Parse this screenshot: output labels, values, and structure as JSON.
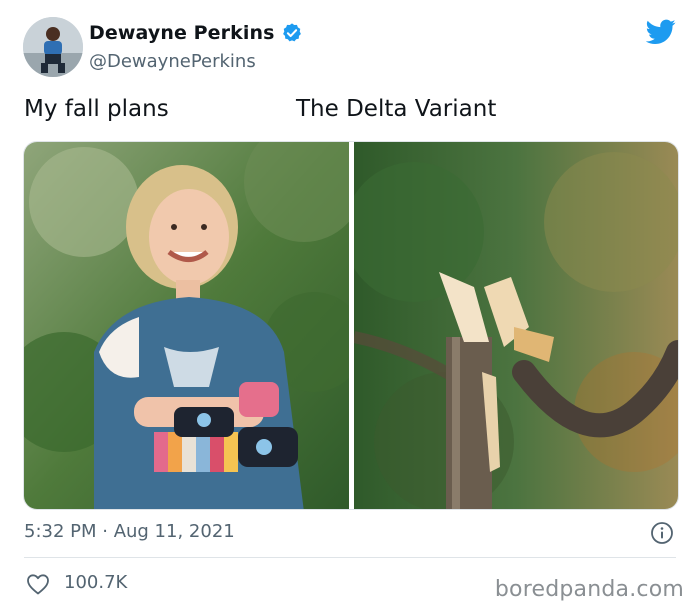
{
  "tweet": {
    "author": {
      "display_name": "Dewayne Perkins",
      "handle": "@DewaynePerkins",
      "verified": true
    },
    "captions": {
      "left": "My fall plans",
      "right": "The Delta Variant"
    },
    "images": {
      "left": "photo-smiling-girl-arm-cast",
      "right": "photo-broken-tree-branch"
    },
    "timestamp": "5:32 PM · Aug 11, 2021",
    "likes": "100.7K"
  },
  "footer": {
    "watermark": "boredpanda.com"
  },
  "colors": {
    "twitter_blue": "#1d9bf0",
    "text_primary": "#0f1419",
    "text_secondary": "#536471",
    "divider": "#dfe4e8"
  },
  "icons": {
    "verified": "verified-badge-icon",
    "brand": "twitter-bird-icon",
    "info": "info-icon",
    "like": "heart-icon"
  }
}
